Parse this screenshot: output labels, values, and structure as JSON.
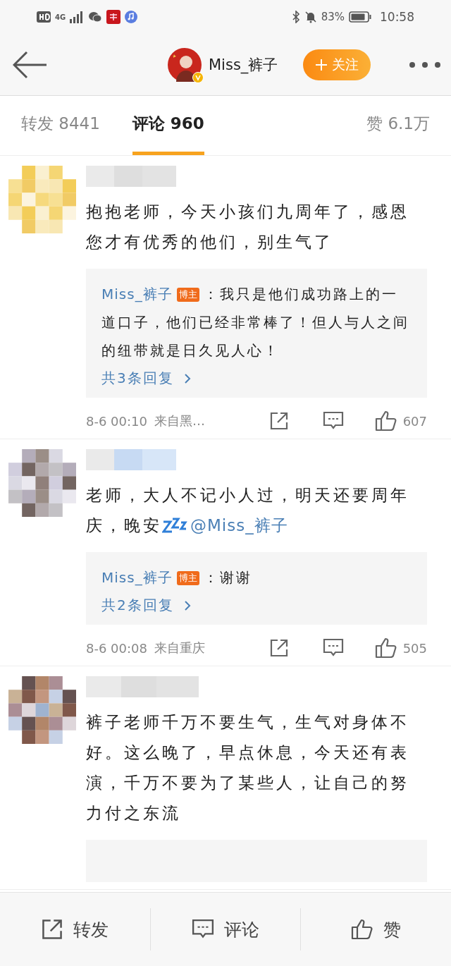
{
  "status_bar": {
    "network": "4G",
    "battery": "83%",
    "time": "10:58"
  },
  "header": {
    "author": "Miss_裤子",
    "verified": true,
    "follow": "关注"
  },
  "tabs": [
    {
      "label": "转发 8441",
      "selected": false
    },
    {
      "label": "评论 960",
      "selected": true
    },
    {
      "label": "赞 6.1万",
      "selected": false
    }
  ],
  "comments": [
    {
      "segments": [
        {
          "kind": "text",
          "text": "抱抱老师，今天小孩们九周年了，感恩您才有优秀的他们，别生气了"
        }
      ],
      "reply": {
        "author": "Miss_裤子",
        "badge": "博主",
        "text": "：我只是他们成功路上的一道口子，他们已经非常棒了！但人与人之间的纽带就是日久见人心！",
        "more": "共3条回复"
      },
      "meta": {
        "time": "8-6 00:10",
        "source": "来自黑…",
        "likes": "607"
      }
    },
    {
      "segments": [
        {
          "kind": "text",
          "text": "老师，大人不记小人过，明天还要周年庆，晚安"
        },
        {
          "kind": "sleep"
        },
        {
          "kind": "mention",
          "text": "@Miss_裤子"
        }
      ],
      "reply": {
        "author": "Miss_裤子",
        "badge": "博主",
        "text": "：谢谢",
        "more": "共2条回复"
      },
      "meta": {
        "time": "8-6 00:08",
        "source": "来自重庆",
        "likes": "505"
      }
    },
    {
      "segments": [
        {
          "kind": "text",
          "text": "裤子老师千万不要生气，生气对身体不好。这么晚了，早点休息，今天还有表演，千万不要为了某些人，让自己的努力付之东流"
        }
      ],
      "reply_peek": true
    }
  ],
  "bottom_bar": [
    {
      "kind": "share",
      "label": "转发"
    },
    {
      "kind": "comment",
      "label": "评论"
    },
    {
      "kind": "like",
      "label": "赞"
    }
  ]
}
